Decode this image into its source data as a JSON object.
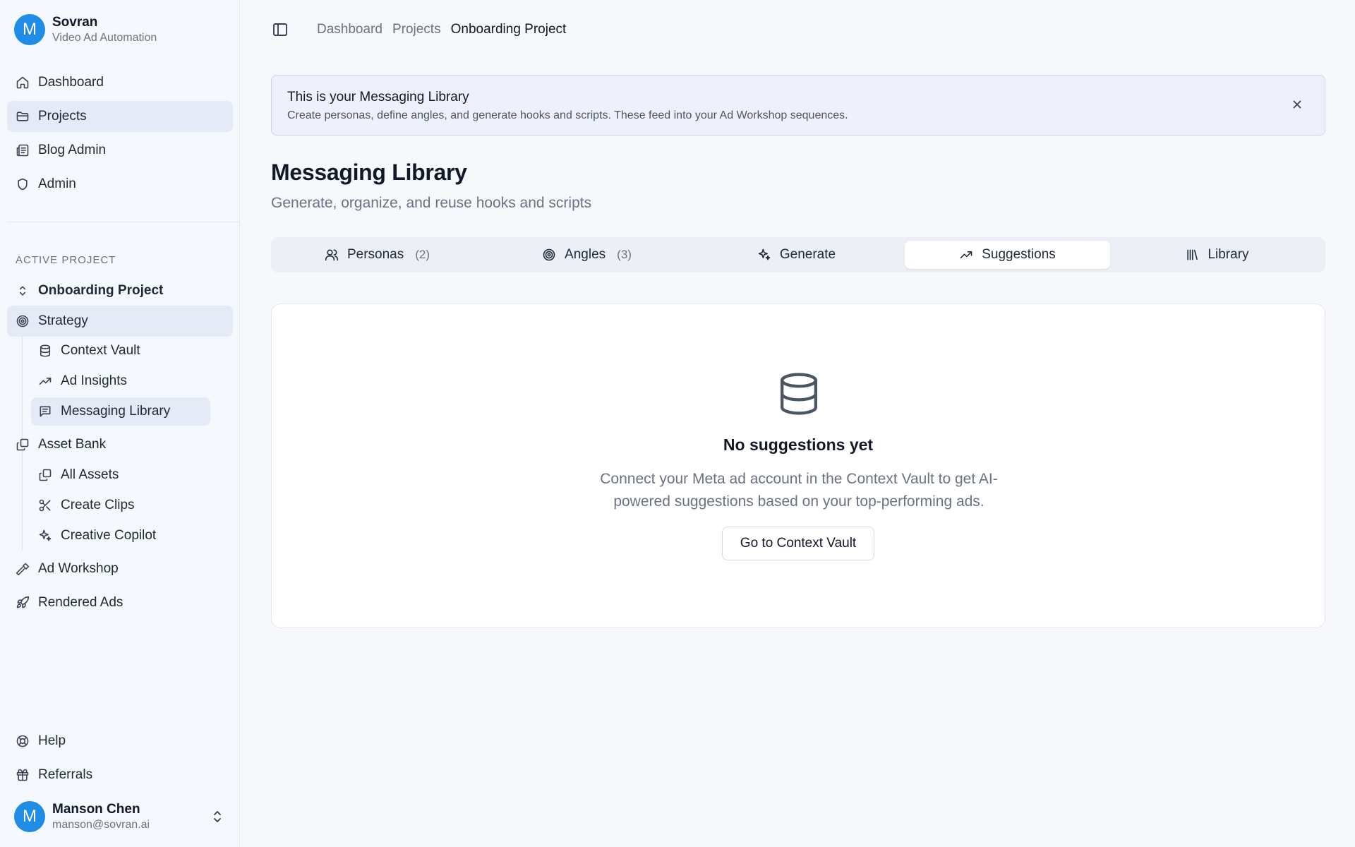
{
  "brand": {
    "initial": "M",
    "name": "Sovran",
    "subtitle": "Video Ad Automation"
  },
  "nav": [
    {
      "label": "Dashboard",
      "icon": "home-icon"
    },
    {
      "label": "Projects",
      "icon": "folder-icon"
    },
    {
      "label": "Blog Admin",
      "icon": "newspaper-icon"
    },
    {
      "label": "Admin",
      "icon": "shield-icon"
    }
  ],
  "project": {
    "section_label": "ACTIVE PROJECT",
    "name": "Onboarding Project",
    "strategy": "Strategy",
    "strategy_items": [
      "Context Vault",
      "Ad Insights",
      "Messaging Library"
    ],
    "asset_bank": "Asset Bank",
    "asset_items": [
      "All Assets",
      "Create Clips",
      "Creative Copilot"
    ],
    "ad_workshop": "Ad Workshop",
    "rendered_ads": "Rendered Ads"
  },
  "footer_nav": {
    "help": "Help",
    "referrals": "Referrals"
  },
  "user": {
    "initial": "M",
    "name": "Manson Chen",
    "email": "manson@sovran.ai"
  },
  "breadcrumb": [
    "Dashboard",
    "Projects",
    "Onboarding Project"
  ],
  "banner": {
    "title": "This is your Messaging Library",
    "text": "Create personas, define angles, and generate hooks and scripts. These feed into your Ad Workshop sequences."
  },
  "page": {
    "title": "Messaging Library",
    "subtitle": "Generate, organize, and reuse hooks and scripts"
  },
  "tabs": [
    {
      "label": "Personas",
      "count": "(2)"
    },
    {
      "label": "Angles",
      "count": "(3)"
    },
    {
      "label": "Generate",
      "count": ""
    },
    {
      "label": "Suggestions",
      "count": ""
    },
    {
      "label": "Library",
      "count": ""
    }
  ],
  "active_tab": "Suggestions",
  "empty_state": {
    "title": "No suggestions yet",
    "text": "Connect your Meta ad account in the Context Vault to get AI-powered suggestions based on your top-performing ads.",
    "button": "Go to Context Vault"
  },
  "colors": {
    "accent": "#1f8de5",
    "active_bg": "#e4ebf6",
    "banner_bg": "#eef1fb"
  }
}
